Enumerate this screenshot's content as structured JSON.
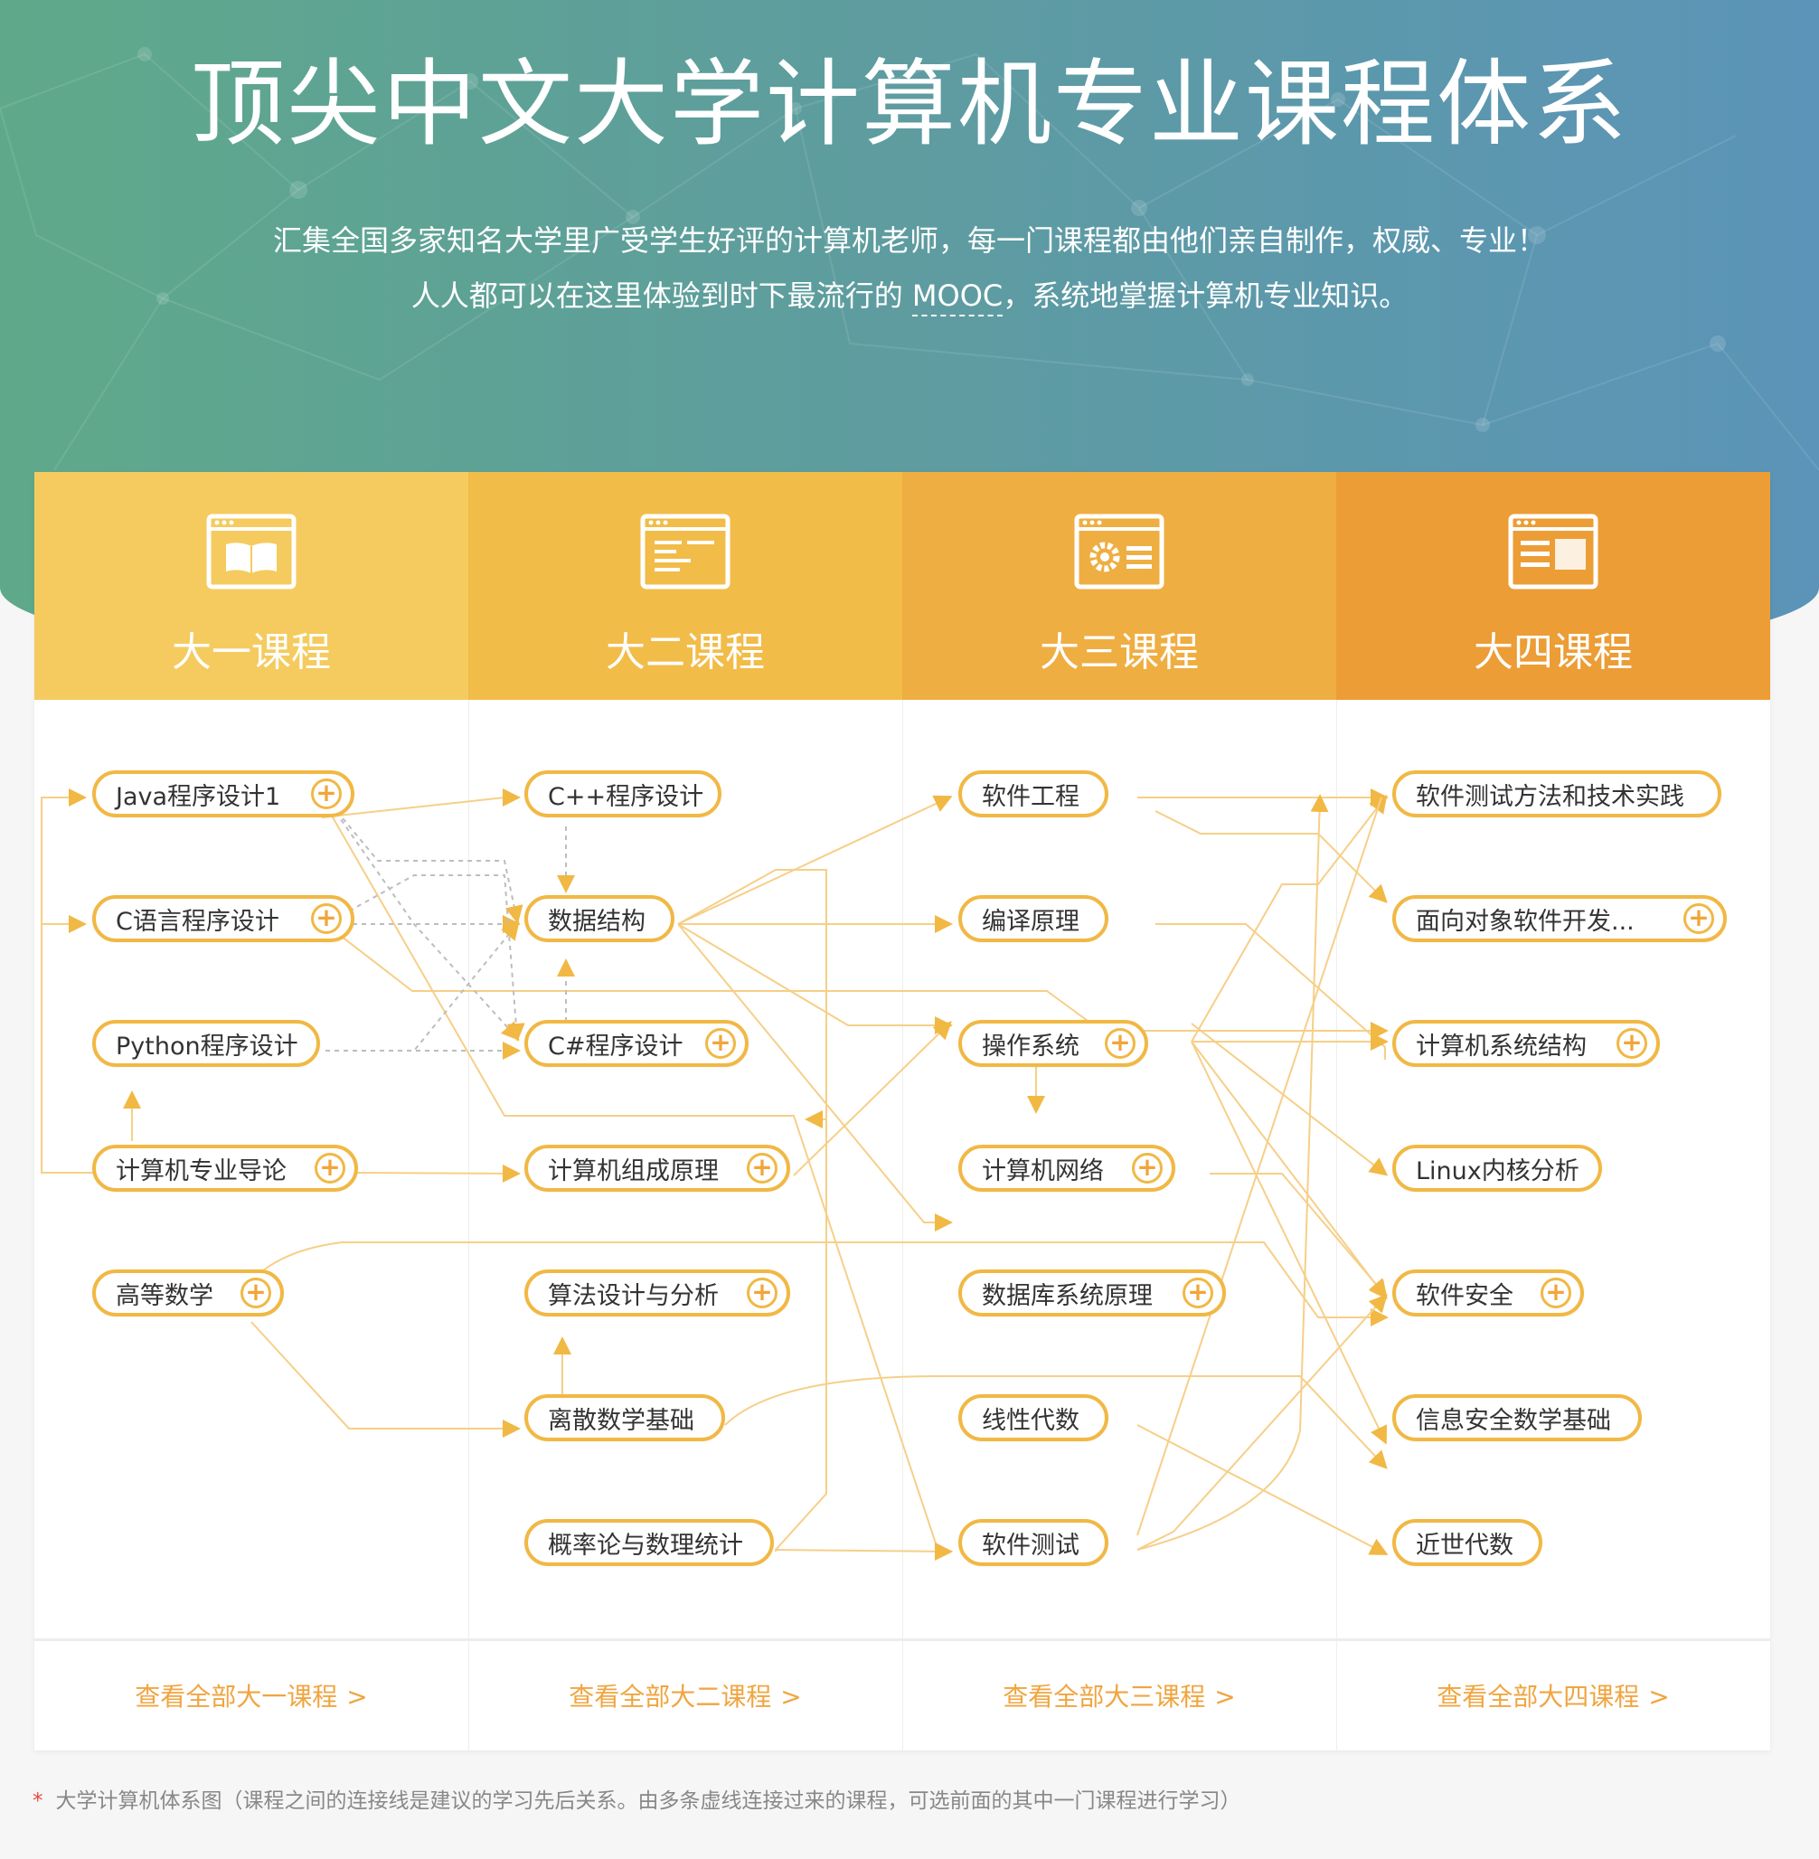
{
  "hero": {
    "title": "顶尖中文大学计算机专业课程体系",
    "desc_line1": "汇集全国多家知名大学里广受学生好评的计算机老师，每一门课程都由他们亲自制作，权威、专业！",
    "desc_line2_pre": "人人都可以在这里体验到时下最流行的 ",
    "desc_line2_link": "MOOC",
    "desc_line2_post": "，系统地掌握计算机专业知识。"
  },
  "colors": {
    "accent": "#f1b844",
    "link": "#f0a540",
    "head1": "#f5cb5f",
    "head2": "#f2bc49",
    "head3": "#efae42",
    "head4": "#ec9d35"
  },
  "columns": [
    {
      "title": "大一课程",
      "icon": "book-window-icon",
      "view_all": "查看全部大一课程",
      "arrow": ">"
    },
    {
      "title": "大二课程",
      "icon": "document-window-icon",
      "view_all": "查看全部大二课程",
      "arrow": ">"
    },
    {
      "title": "大三课程",
      "icon": "settings-window-icon",
      "view_all": "查看全部大三课程",
      "arrow": ">"
    },
    {
      "title": "大四课程",
      "icon": "layout-window-icon",
      "view_all": "查看全部大四课程",
      "arrow": ">"
    }
  ],
  "courses": {
    "year1": [
      {
        "label": "Java程序设计1",
        "plus": true
      },
      {
        "label": "C语言程序设计",
        "plus": true
      },
      {
        "label": "Python程序设计",
        "plus": false
      },
      {
        "label": "计算机专业导论",
        "plus": true
      },
      {
        "label": "高等数学",
        "plus": true
      }
    ],
    "year2": [
      {
        "label": "C++程序设计",
        "plus": false
      },
      {
        "label": "数据结构",
        "plus": false
      },
      {
        "label": "C#程序设计",
        "plus": true
      },
      {
        "label": "计算机组成原理",
        "plus": true
      },
      {
        "label": "算法设计与分析",
        "plus": true
      },
      {
        "label": "离散数学基础",
        "plus": false
      },
      {
        "label": "概率论与数理统计",
        "plus": false
      }
    ],
    "year3": [
      {
        "label": "软件工程",
        "plus": false
      },
      {
        "label": "编译原理",
        "plus": false
      },
      {
        "label": "操作系统",
        "plus": true
      },
      {
        "label": "计算机网络",
        "plus": true
      },
      {
        "label": "数据库系统原理",
        "plus": true
      },
      {
        "label": "线性代数",
        "plus": false
      },
      {
        "label": "软件测试",
        "plus": false
      }
    ],
    "year4": [
      {
        "label": "软件测试方法和技术实践",
        "plus": false
      },
      {
        "label": "面向对象软件开发...",
        "plus": true
      },
      {
        "label": "计算机系统结构",
        "plus": true
      },
      {
        "label": "Linux内核分析",
        "plus": false
      },
      {
        "label": "软件安全",
        "plus": true
      },
      {
        "label": "信息安全数学基础",
        "plus": false
      },
      {
        "label": "近世代数",
        "plus": false
      }
    ]
  },
  "plus_symbol": "+",
  "footnote": {
    "star": "*",
    "text": "大学计算机体系图（课程之间的连接线是建议的学习先后关系。由多条虚线连接过来的课程，可选前面的其中一门课程进行学习）"
  }
}
